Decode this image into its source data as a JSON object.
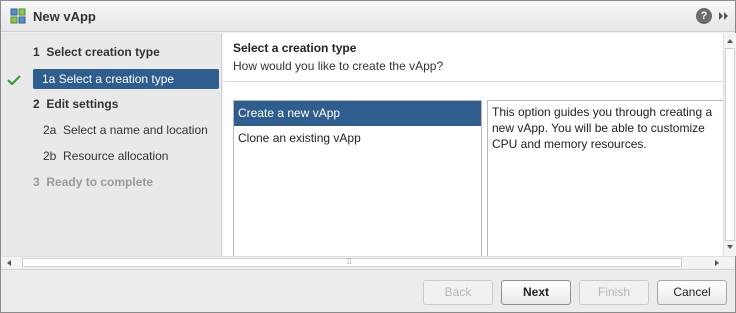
{
  "window": {
    "title": "New vApp",
    "help_icon_glyph": "?",
    "accent_color": "#2f5e8e"
  },
  "steps": [
    {
      "num": "1",
      "label": "Select creation type",
      "kind": "group"
    },
    {
      "num": "1a",
      "label": "Select a creation type",
      "kind": "active"
    },
    {
      "num": "2",
      "label": "Edit settings",
      "kind": "group"
    },
    {
      "num": "2a",
      "label": "Select a name and location",
      "kind": "sub"
    },
    {
      "num": "2b",
      "label": "Resource allocation",
      "kind": "sub"
    },
    {
      "num": "3",
      "label": "Ready to complete",
      "kind": "disabled"
    }
  ],
  "content": {
    "title": "Select a creation type",
    "subtitle": "How would you like to create the vApp?",
    "options": [
      "Create a new vApp",
      "Clone an existing vApp"
    ],
    "selected_option": "Create a new vApp",
    "description": "This option guides you through creating a new vApp. You will be able to customize CPU and memory resources."
  },
  "scrollbar": {
    "grip_glyph": "⁞⁞"
  },
  "footer": {
    "back_label": "Back",
    "next_label": "Next",
    "finish_label": "Finish",
    "cancel_label": "Cancel"
  }
}
